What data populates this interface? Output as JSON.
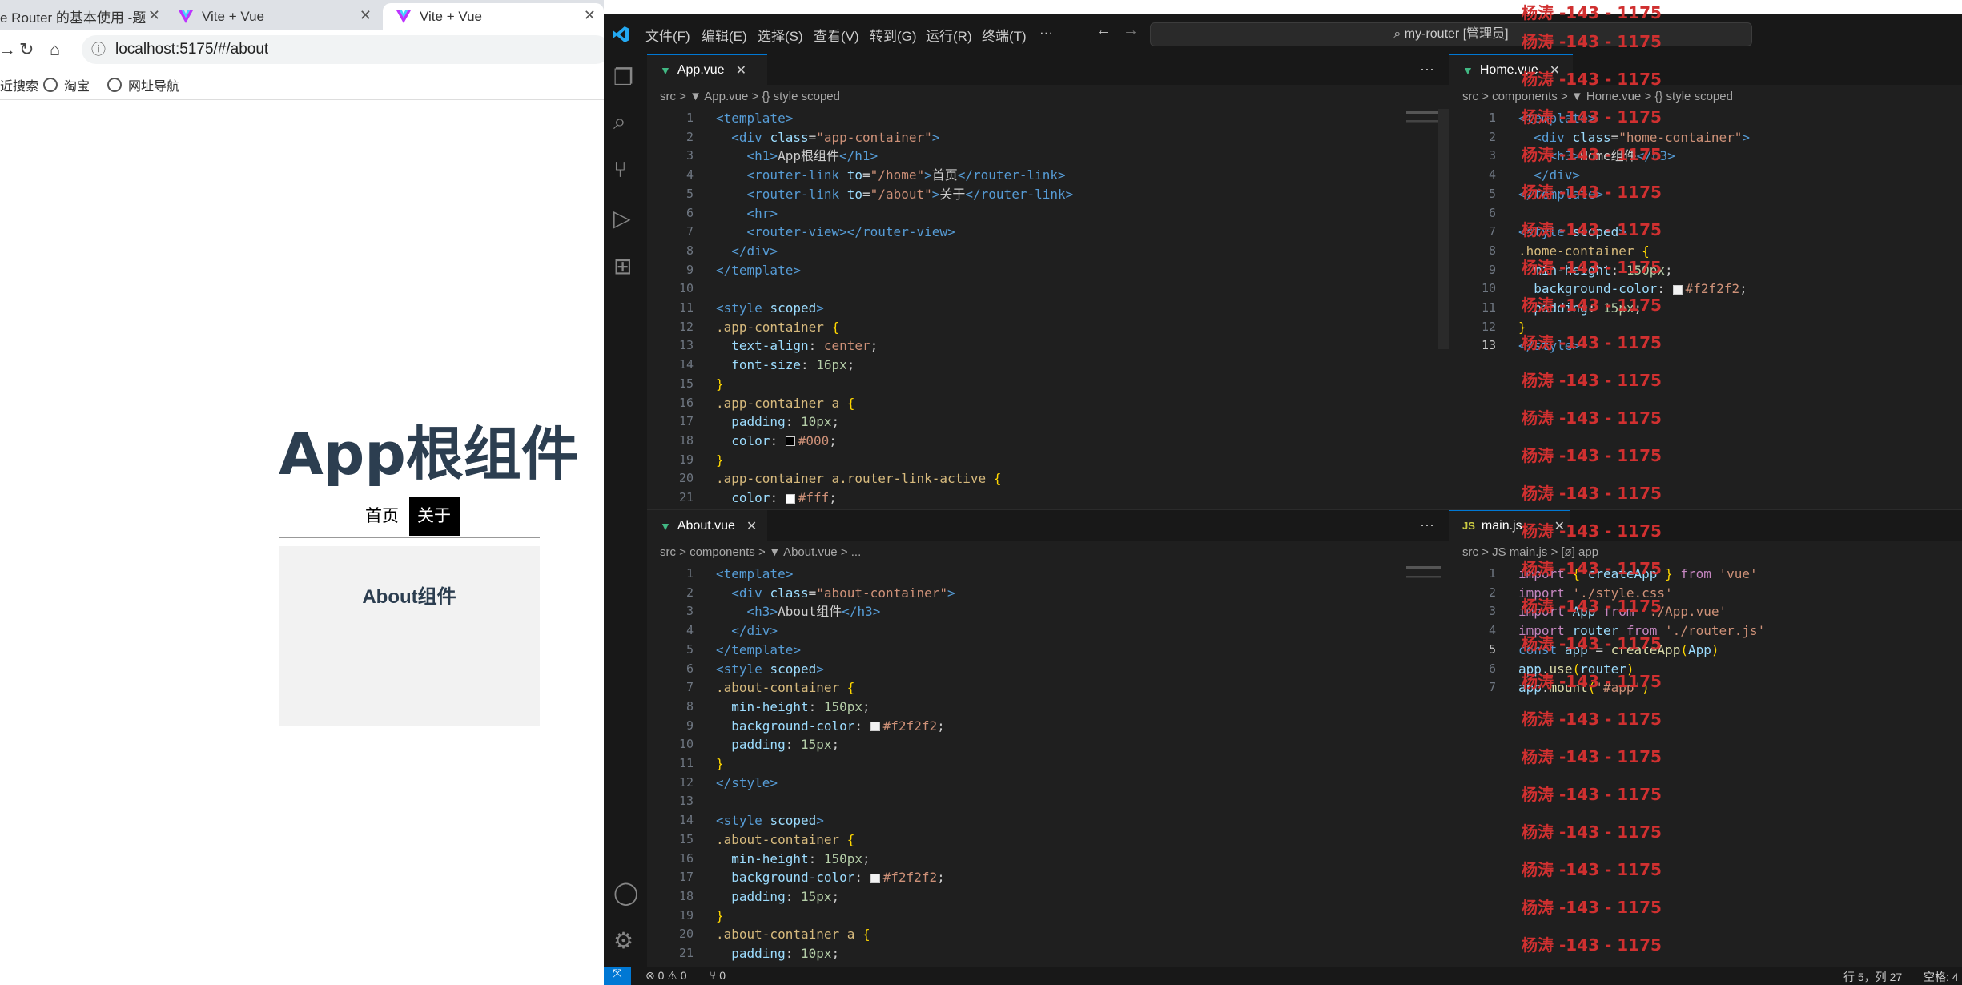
{
  "browser": {
    "tabs": [
      {
        "label": "e Router 的基本使用 -题"
      },
      {
        "label": "Vite + Vue"
      },
      {
        "label": "Vite + Vue"
      }
    ],
    "url": "localhost:5175/#/about",
    "bookmarks": [
      "近搜索",
      "淘宝",
      "网址导航"
    ],
    "page": {
      "title": "App根组件",
      "link_home": "首页",
      "link_about": "关于",
      "about_text": "About组件"
    }
  },
  "vscode": {
    "menu": [
      "文件(F)",
      "编辑(E)",
      "选择(S)",
      "查看(V)",
      "转到(G)",
      "运行(R)",
      "终端(T)",
      "···"
    ],
    "search": "my-router [管理员]",
    "panes": {
      "app": {
        "tab": "App.vue",
        "crumb": "src > ▼ App.vue > {} style scoped"
      },
      "home": {
        "tab": "Home.vue",
        "crumb": "src > components > ▼ Home.vue > {} style scoped"
      },
      "about": {
        "tab": "About.vue",
        "crumb": "src > components > ▼ About.vue > ..."
      },
      "main": {
        "tab": "main.js",
        "crumb": "src > JS main.js > [ø] app"
      }
    },
    "status": {
      "errors": "⊗ 0 ⚠ 0",
      "ports": "⑂ 0",
      "position": "行 5，列 27",
      "spaces": "空格: 4"
    },
    "watermark": "杨涛 -143 - 1175"
  },
  "icons": [
    "vue-logo-icon",
    "reload-icon",
    "home-icon",
    "info-icon",
    "globe-icon",
    "vscode-logo-icon",
    "files-icon",
    "search-icon",
    "source-control-icon",
    "run-debug-icon",
    "extensions-icon",
    "account-icon",
    "settings-icon"
  ]
}
